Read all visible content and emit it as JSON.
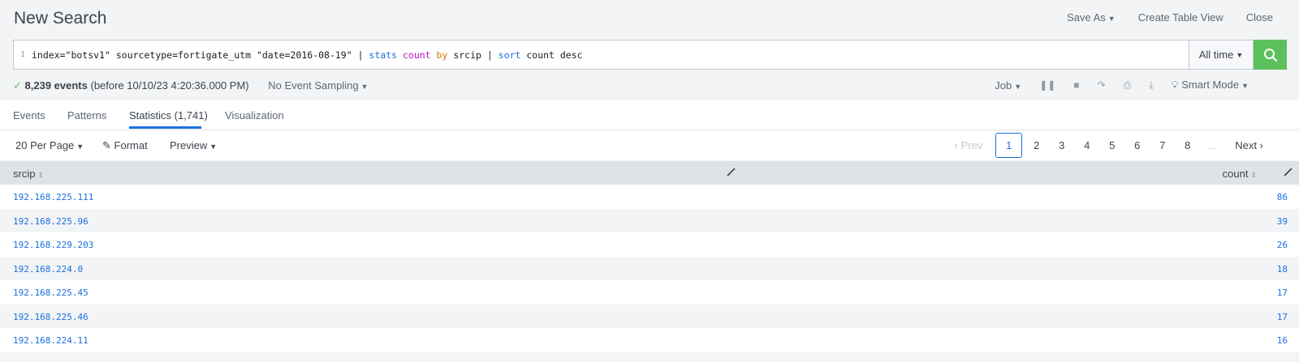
{
  "header": {
    "title": "New Search",
    "save_as": "Save As",
    "create_table_view": "Create Table View",
    "close": "Close"
  },
  "search": {
    "line_number": "1",
    "query_parts": {
      "p1": "index=\"botsv1\" sourcetype=fortigate_utm \"date=2016-08-19\" | ",
      "stats": "stats",
      "sp1": " ",
      "count": "count",
      "sp2": " ",
      "by": "by",
      "p2": " srcip | ",
      "sort": "sort",
      "p3": " count desc"
    },
    "time_range": "All time"
  },
  "status": {
    "events": "8,239 events",
    "before": "(before 10/10/23 4:20:36.000 PM)",
    "sampling": "No Event Sampling"
  },
  "job": {
    "job_label": "Job",
    "mode": "Smart Mode"
  },
  "tabs": [
    {
      "label": "Events"
    },
    {
      "label": "Patterns"
    },
    {
      "label": "Statistics (1,741)"
    },
    {
      "label": "Visualization"
    }
  ],
  "toolbar": {
    "per_page": "20 Per Page",
    "format": "Format",
    "preview": "Preview"
  },
  "pager": {
    "prev": "Prev",
    "pages": [
      "1",
      "2",
      "3",
      "4",
      "5",
      "6",
      "7",
      "8"
    ],
    "ellipsis": "...",
    "next": "Next"
  },
  "table": {
    "columns": [
      "srcip",
      "count"
    ],
    "rows": [
      {
        "srcip": "192.168.225.111",
        "count": "86"
      },
      {
        "srcip": "192.168.225.96",
        "count": "39"
      },
      {
        "srcip": "192.168.229.203",
        "count": "26"
      },
      {
        "srcip": "192.168.224.0",
        "count": "18"
      },
      {
        "srcip": "192.168.225.45",
        "count": "17"
      },
      {
        "srcip": "192.168.225.46",
        "count": "17"
      },
      {
        "srcip": "192.168.224.11",
        "count": "16"
      }
    ]
  },
  "colors": {
    "accent": "#1a6fe0",
    "search_button": "#5cc05c"
  }
}
